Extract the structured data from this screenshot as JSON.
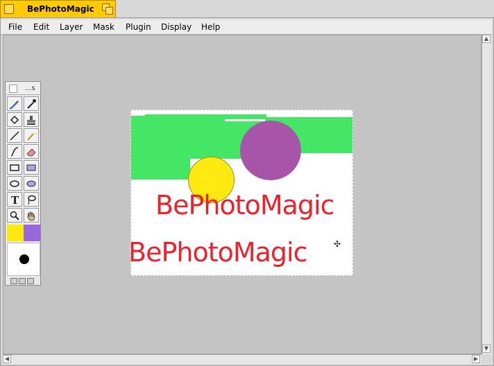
{
  "window": {
    "title": "BePhotoMagic"
  },
  "menu": [
    "File",
    "Edit",
    "Layer",
    "Mask",
    "Plugin",
    "Display",
    "Help"
  ],
  "palette": {
    "header_label": "...s"
  },
  "image": {
    "text_line_1": "BePhotoMagic",
    "text_line_2": "BePhotoMagic",
    "text_color": "#f0202a",
    "shapes": [
      {
        "kind": "green-strokes",
        "color": "#45e565"
      },
      {
        "kind": "circle",
        "color": "#a755a8"
      },
      {
        "kind": "circle",
        "color": "#ffe910"
      }
    ]
  },
  "colors": {
    "foreground": "#ffe910",
    "background": "#9966dd",
    "accent": "#ffcb00"
  },
  "tools": [
    "brush-tool",
    "eyedropper-tool",
    "fill-tool",
    "stamp-tool",
    "line-tool",
    "magic-wand-tool",
    "curve-tool",
    "eraser-tool",
    "rectangle-tool",
    "filled-rectangle-tool",
    "ellipse-tool",
    "filled-ellipse-tool",
    "text-tool",
    "lasso-tool",
    "zoom-tool",
    "hand-tool"
  ]
}
